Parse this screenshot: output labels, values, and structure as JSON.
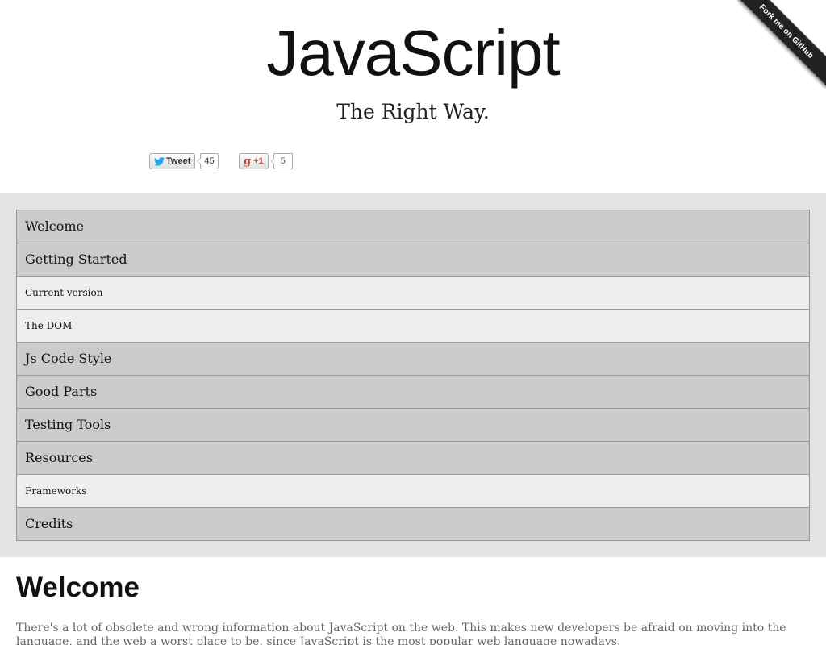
{
  "header": {
    "title": "JavaScript",
    "subtitle": "The Right Way."
  },
  "social": {
    "tweet_label": "Tweet",
    "tweet_count": "45",
    "gplus_label": "+1",
    "gplus_count": "5"
  },
  "ribbon": {
    "label": "Fork me on GitHub"
  },
  "nav": {
    "items": [
      {
        "label": "Welcome",
        "level": "top"
      },
      {
        "label": "Getting Started",
        "level": "top"
      },
      {
        "label": "Current version",
        "level": "sub"
      },
      {
        "label": "The DOM",
        "level": "sub"
      },
      {
        "label": "Js Code Style",
        "level": "top"
      },
      {
        "label": "Good Parts",
        "level": "top"
      },
      {
        "label": "Testing Tools",
        "level": "top"
      },
      {
        "label": "Resources",
        "level": "top"
      },
      {
        "label": "Frameworks",
        "level": "sub"
      },
      {
        "label": "Credits",
        "level": "top"
      }
    ]
  },
  "content": {
    "section_title": "Welcome",
    "intro": "There's a lot of obsolete and wrong information about JavaScript on the web. This makes new developers be afraid on moving into the language, and the web a worst place to be, since JavaScript is the most popular web language nowadays."
  }
}
